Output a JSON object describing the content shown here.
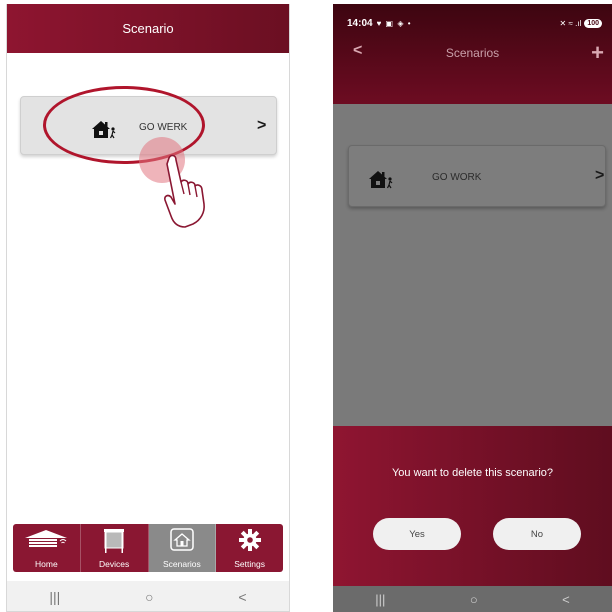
{
  "left": {
    "header_title": "Scenario",
    "scenario": {
      "label": "GO WERK",
      "icon": "house-person-icon"
    },
    "tabs": [
      {
        "label": "Home",
        "icon": "home-logo-icon",
        "active": false
      },
      {
        "label": "Devices",
        "icon": "screen-device-icon",
        "active": false
      },
      {
        "label": "Scenarios",
        "icon": "house-scenario-icon",
        "active": true
      },
      {
        "label": "Settings",
        "icon": "gear-icon",
        "active": false
      }
    ],
    "nav": {
      "recents": "|||",
      "home": "○",
      "back": "<"
    }
  },
  "right": {
    "status": {
      "time": "14:04",
      "icons": "♥ ▣ ◈ •",
      "right_icons": "✕ ≈ .ıl",
      "battery": "100"
    },
    "header_title": "Scenarios",
    "back": "<",
    "add": "+",
    "scenario": {
      "label": "GO WORK",
      "icon": "house-person-icon"
    },
    "dialog": {
      "message": "You want to delete this scenario?",
      "yes": "Yes",
      "no": "No"
    },
    "nav": {
      "recents": "|||",
      "home": "○",
      "back": "<"
    }
  },
  "colors": {
    "brand": "#8a1732",
    "brand_dark": "#4a0a18",
    "annotation": "#b0152c"
  }
}
